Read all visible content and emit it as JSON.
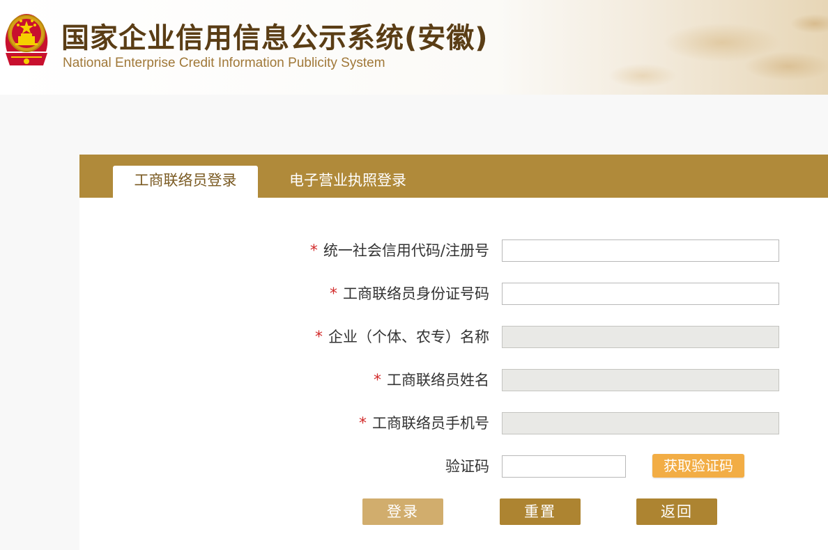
{
  "header": {
    "title": "国家企业信用信息公示系统(安徽)",
    "subtitle": "National Enterprise Credit Information Publicity System"
  },
  "tabs": [
    {
      "label": "工商联络员登录",
      "active": true
    },
    {
      "label": "电子营业执照登录",
      "active": false
    }
  ],
  "form": {
    "required_mark": "*",
    "fields": [
      {
        "label": "统一社会信用代码/注册号",
        "required": true,
        "value": "",
        "disabled": false
      },
      {
        "label": "工商联络员身份证号码",
        "required": true,
        "value": "",
        "disabled": false
      },
      {
        "label": "企业（个体、农专）名称",
        "required": true,
        "value": "",
        "disabled": true
      },
      {
        "label": "工商联络员姓名",
        "required": true,
        "value": "",
        "disabled": true
      },
      {
        "label": "工商联络员手机号",
        "required": true,
        "value": "",
        "disabled": true
      }
    ],
    "captcha": {
      "label": "验证码",
      "value": "",
      "button_label": "获取验证码"
    }
  },
  "buttons": {
    "login": "登录",
    "reset": "重置",
    "back": "返回"
  },
  "colors": {
    "brand": "#b08a3a",
    "title": "#5a3d15",
    "required": "#d22b2b",
    "captcha_button": "#f2ad45",
    "login_button": "#d1ad6d"
  }
}
